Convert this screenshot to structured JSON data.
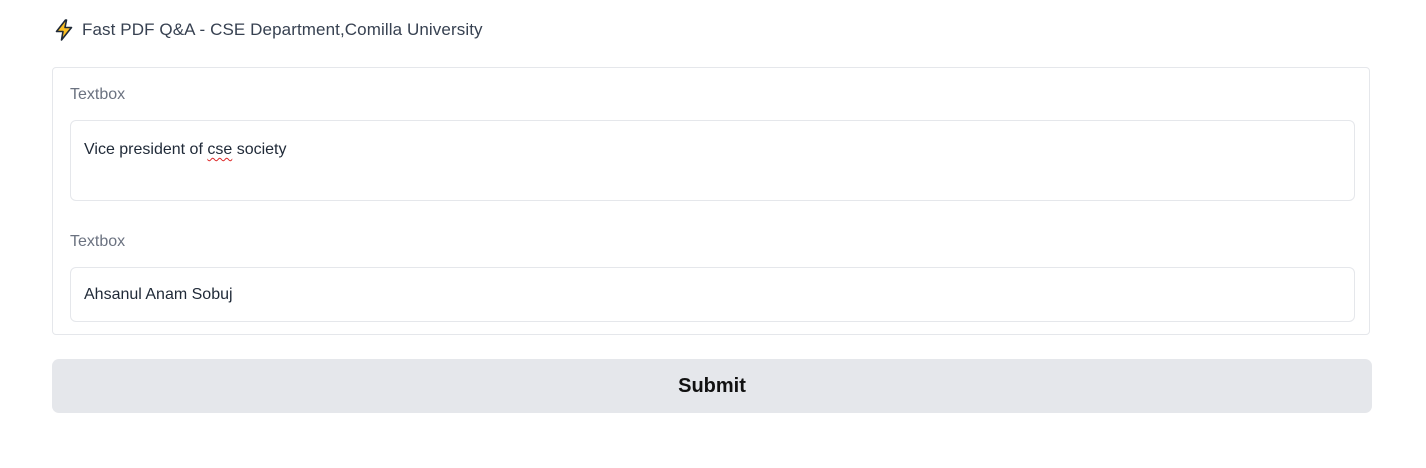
{
  "header": {
    "icon": "lightning-bolt-icon",
    "title": "Fast PDF Q&A - CSE Department,Comilla University"
  },
  "form": {
    "fields": [
      {
        "label": "Textbox",
        "value_prefix": "Vice president of ",
        "value_misspelled": "cse",
        "value_suffix": " society"
      },
      {
        "label": "Textbox",
        "value": "Ahsanul Anam Sobuj"
      }
    ]
  },
  "actions": {
    "submit_label": "Submit"
  },
  "colors": {
    "icon_fill": "#fbbf24",
    "icon_stroke": "#1f2937",
    "button_bg": "#e5e7eb",
    "border": "#e5e7eb",
    "spellcheck_underline": "#dc2626"
  }
}
